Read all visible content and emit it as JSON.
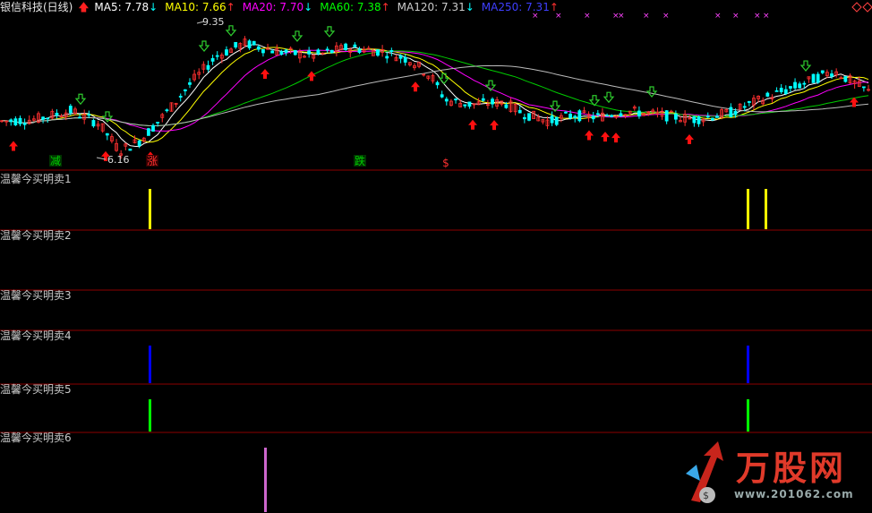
{
  "header": {
    "stock_name": "银信科技(日线)",
    "ma": [
      {
        "label": "MA5: 7.78",
        "arrow": "↓",
        "color": "#ffffff"
      },
      {
        "label": "MA10: 7.66",
        "arrow": "↑",
        "color": "#ffff00"
      },
      {
        "label": "MA20: 7.70",
        "arrow": "↓",
        "color": "#ff00ff"
      },
      {
        "label": "MA60: 7.38",
        "arrow": "↑",
        "color": "#00ff00"
      },
      {
        "label": "MA120: 7.31",
        "arrow": "↓",
        "color": "#cccccc"
      },
      {
        "label": "MA250: 7.31",
        "arrow": "↑",
        "color": "#3f3fff"
      }
    ]
  },
  "panel_labels": [
    "温馨今买明卖1",
    "温馨今买明卖2",
    "温馨今买明卖3",
    "温馨今买明卖4",
    "温馨今买明卖5",
    "温馨今买明卖6"
  ],
  "price_labels": {
    "high": "9.35",
    "low": "6.16"
  },
  "markers": [
    {
      "text": "减",
      "color": "#00cc00",
      "bg": "#003300"
    },
    {
      "text": "涨",
      "color": "#ff3030",
      "bg": "#330000"
    },
    {
      "text": "跌",
      "color": "#00cc00",
      "bg": "#003300"
    },
    {
      "text": "$",
      "color": "#ff3030",
      "bg": "#000000"
    }
  ],
  "watermark": {
    "title": "万股网",
    "url": "www.201062.com"
  },
  "colors": {
    "up": "#ff3030",
    "down": "#00ffff",
    "grid": "#8b0000",
    "buy_arrow": "#ff1010",
    "sell_arrow": "#2ecc2e"
  },
  "chart_data": {
    "type": "candlestick",
    "price_range_visible": [
      6.16,
      9.35
    ],
    "moving_averages": {
      "MA5": 7.78,
      "MA10": 7.66,
      "MA20": 7.7,
      "MA60": 7.38,
      "MA120": 7.31,
      "MA250": 7.31
    },
    "signal_panels": [
      {
        "name": "温馨今买明卖1",
        "color": "#ffff00",
        "bars": [
          0.171,
          0.857,
          0.878
        ]
      },
      {
        "name": "温馨今买明卖2",
        "color": "#ffff00",
        "bars": []
      },
      {
        "name": "温馨今买明卖3",
        "color": "#ffff00",
        "bars": []
      },
      {
        "name": "温馨今买明卖4",
        "color": "#0000ff",
        "bars": [
          0.171,
          0.857
        ]
      },
      {
        "name": "温馨今买明卖5",
        "color": "#00ff00",
        "bars": [
          0.171,
          0.857
        ]
      },
      {
        "name": "温馨今买明卖6",
        "color": "#cc66cc",
        "bars": [
          0.304
        ]
      }
    ]
  }
}
